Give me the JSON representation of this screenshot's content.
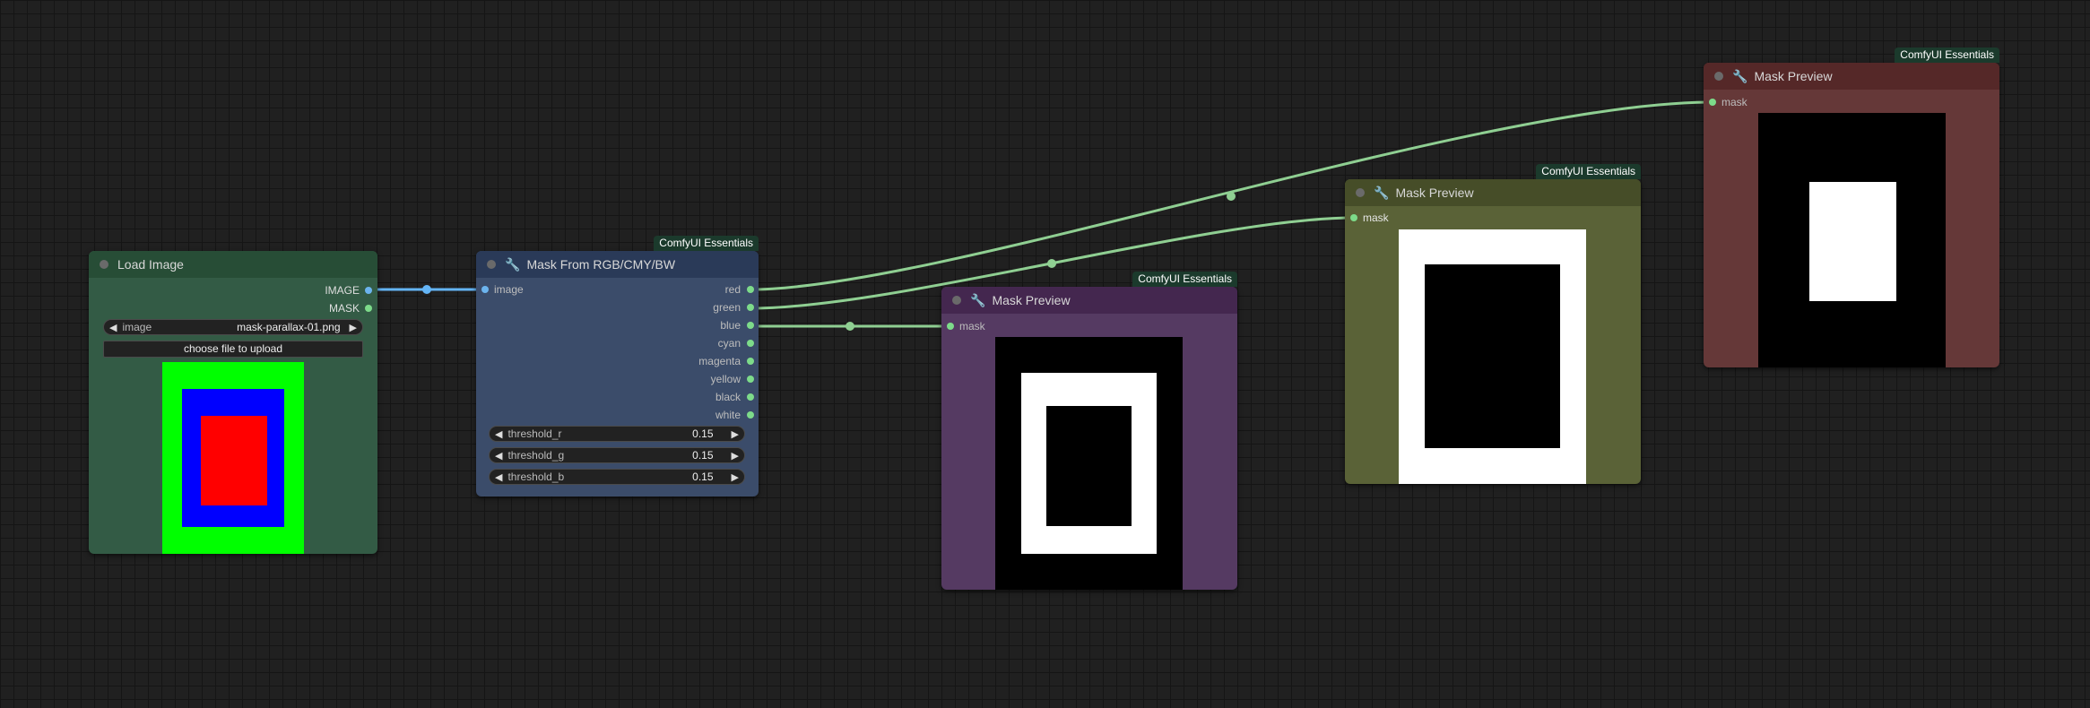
{
  "colors": {
    "canvas_bg": "#202020",
    "wire_mask": "#8fcf92",
    "wire_image": "#64b5f6"
  },
  "load_image": {
    "title": "Load Image",
    "outputs": [
      "IMAGE",
      "MASK"
    ],
    "image_widget": {
      "name": "image",
      "value": "mask-parallax-01.png"
    },
    "upload_button": "choose file to upload"
  },
  "mask_from_rgb": {
    "badge": "ComfyUI Essentials",
    "title": "Mask From RGB/CMY/BW",
    "input": "image",
    "outputs": [
      "red",
      "green",
      "blue",
      "cyan",
      "magenta",
      "yellow",
      "black",
      "white"
    ],
    "widgets": [
      {
        "name": "threshold_r",
        "value": "0.15"
      },
      {
        "name": "threshold_g",
        "value": "0.15"
      },
      {
        "name": "threshold_b",
        "value": "0.15"
      }
    ]
  },
  "preview_blue": {
    "badge": "ComfyUI Essentials",
    "title": "Mask Preview",
    "input": "mask"
  },
  "preview_green": {
    "badge": "ComfyUI Essentials",
    "title": "Mask Preview",
    "input": "mask"
  },
  "preview_red": {
    "badge": "ComfyUI Essentials",
    "title": "Mask Preview",
    "input": "mask"
  }
}
